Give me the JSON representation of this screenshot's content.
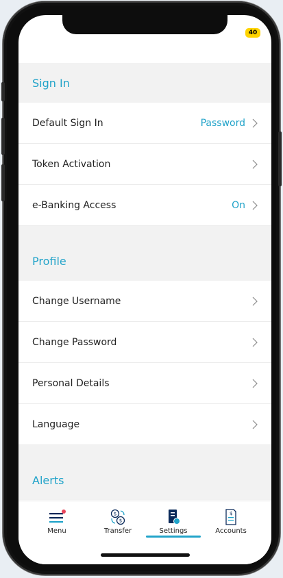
{
  "status": {
    "battery": "40"
  },
  "sections": [
    {
      "title": "Sign In",
      "rows": [
        {
          "label": "Default Sign In",
          "value": "Password"
        },
        {
          "label": "Token Activation",
          "value": ""
        },
        {
          "label": "e-Banking Access",
          "value": "On"
        }
      ]
    },
    {
      "title": "Profile",
      "rows": [
        {
          "label": "Change Username",
          "value": ""
        },
        {
          "label": "Change Password",
          "value": ""
        },
        {
          "label": "Personal Details",
          "value": ""
        },
        {
          "label": "Language",
          "value": ""
        }
      ]
    },
    {
      "title": "Alerts",
      "rows": []
    }
  ],
  "tabbar": {
    "items": [
      {
        "label": "Menu",
        "icon": "menu-icon"
      },
      {
        "label": "Transfer",
        "icon": "transfer-icon"
      },
      {
        "label": "Settings",
        "icon": "settings-icon",
        "active": true
      },
      {
        "label": "Accounts",
        "icon": "accounts-icon"
      }
    ]
  },
  "colors": {
    "accent": "#21a3c9",
    "battery": "#ffd400",
    "badge": "#e8445a"
  }
}
